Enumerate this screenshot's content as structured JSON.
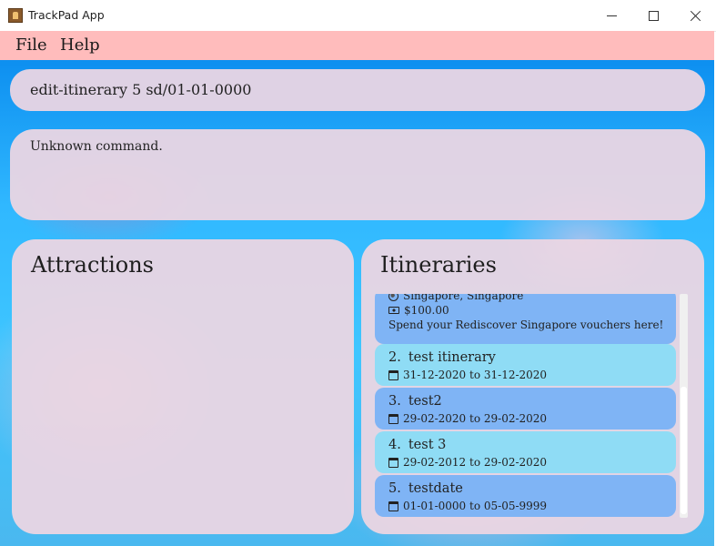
{
  "window": {
    "title": "TrackPad App",
    "controls": [
      "minimize",
      "maximize",
      "close"
    ]
  },
  "menu": {
    "items": [
      {
        "label": "File"
      },
      {
        "label": "Help"
      }
    ]
  },
  "command_box": {
    "value": "edit-itinerary 5 sd/01-01-0000"
  },
  "result_display": {
    "text": "Unknown command."
  },
  "attractions_panel": {
    "title": "Attractions"
  },
  "itineraries_panel": {
    "title": "Itineraries",
    "partial_item": {
      "location": "Singapore, Singapore",
      "budget": "$100.00",
      "description": "Spend your Rediscover Singapore vouchers here!"
    },
    "items": [
      {
        "index": "2.",
        "name": "test itinerary",
        "dates": "31-12-2020 to 31-12-2020"
      },
      {
        "index": "3.",
        "name": "test2",
        "dates": "29-02-2020 to 29-02-2020"
      },
      {
        "index": "4.",
        "name": "test 3",
        "dates": "29-02-2012 to 29-02-2020"
      },
      {
        "index": "5.",
        "name": "testdate",
        "dates": "01-01-0000 to 05-05-9999"
      }
    ]
  },
  "colors": {
    "menu_bar": "#ffbcbc",
    "panel": "#ecd6e2",
    "card_light": "#8fdcf5",
    "card_dark": "#7fb4f5",
    "background_sky": "#30b8ff"
  },
  "icons": {
    "location": "globe-icon",
    "budget": "cash-icon",
    "dates": "calendar-icon"
  }
}
